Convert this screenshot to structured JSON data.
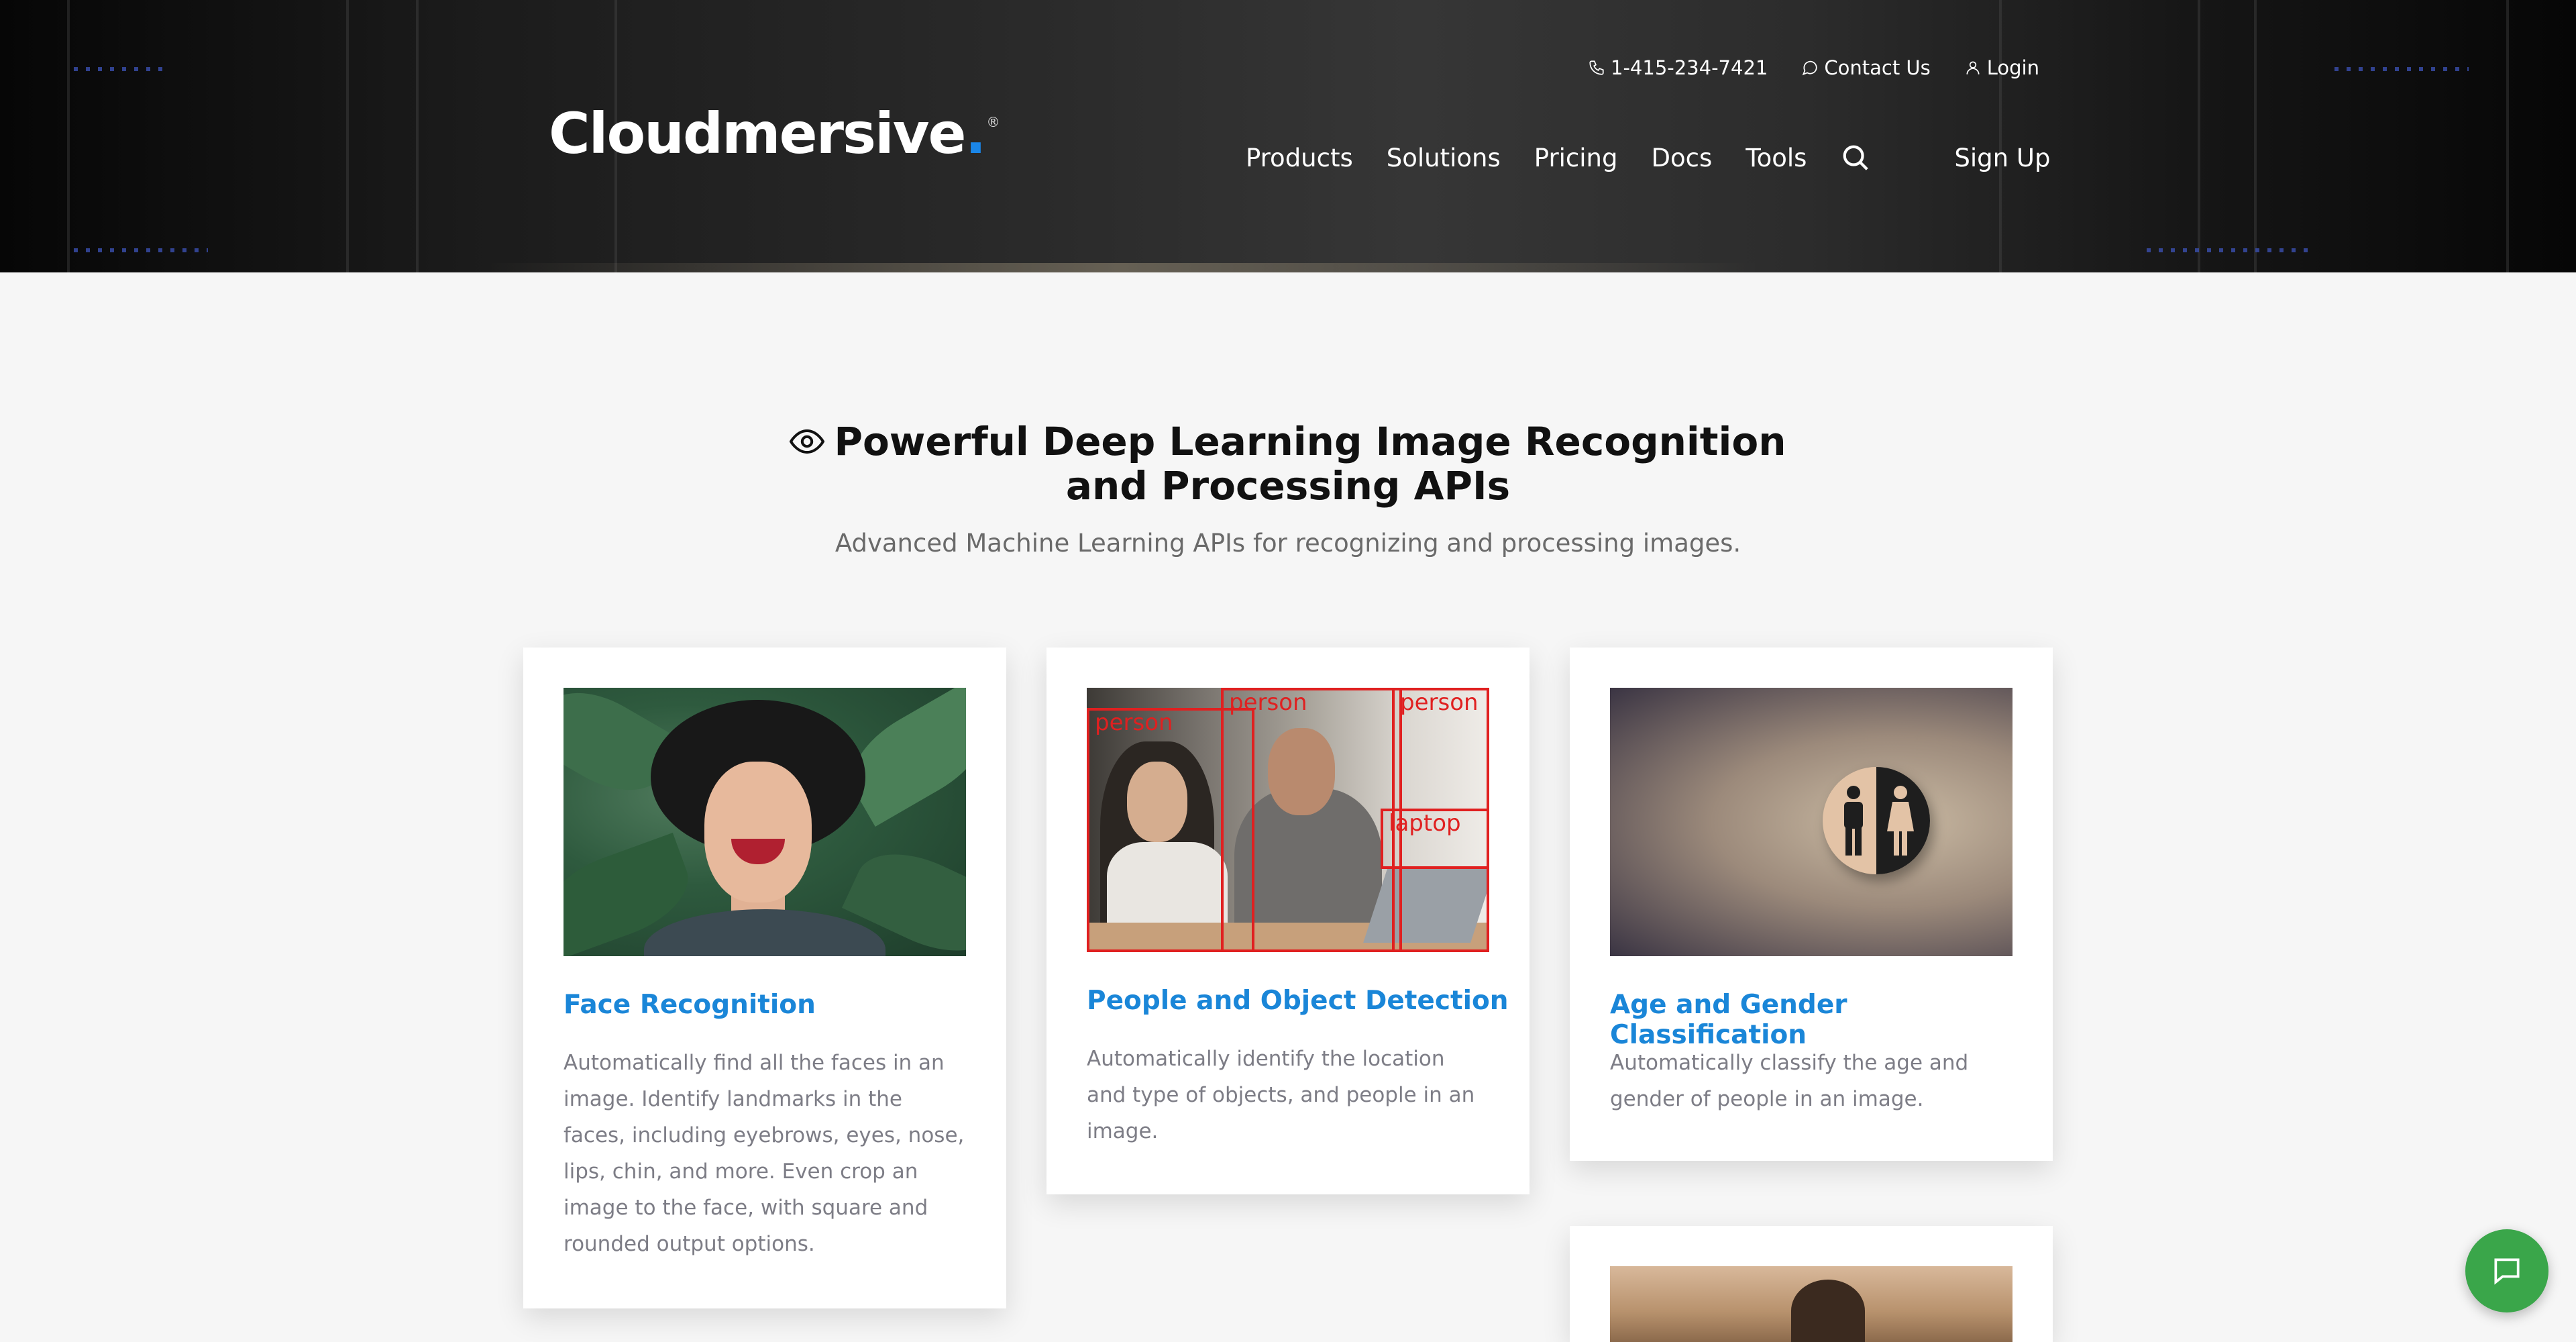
{
  "header": {
    "logo": {
      "text": "Cloudmersive",
      "dot": ".",
      "registered": "®"
    },
    "utility_nav": {
      "phone": {
        "label": "1-415-234-7421",
        "icon": "phone-icon"
      },
      "contact": {
        "label": "Contact Us",
        "icon": "chat-bubble-icon"
      },
      "login": {
        "label": "Login",
        "icon": "user-icon"
      }
    },
    "main_nav": [
      {
        "label": "Products"
      },
      {
        "label": "Solutions"
      },
      {
        "label": "Pricing"
      },
      {
        "label": "Docs"
      },
      {
        "label": "Tools"
      }
    ],
    "search_icon": "search-icon",
    "signup_label": "Sign Up"
  },
  "hero": {
    "icon": "eye-icon",
    "title": "Powerful Deep Learning Image Recognition and Processing APIs",
    "subtitle": "Advanced Machine Learning APIs for recognizing and processing images."
  },
  "cards": [
    {
      "title": "Face Recognition",
      "description": "Automatically find all the faces in an image. Identify landmarks in the faces, including eyebrows, eyes, nose, lips, chin, and more. Even crop an image to the face, with square and rounded output options."
    },
    {
      "title": "People and Object Detection",
      "description": "Automatically identify the location and type of objects, and people in an image.",
      "detections": [
        "person",
        "person",
        "person",
        "laptop"
      ]
    },
    {
      "title": "Age and Gender Classification",
      "description": "Automatically classify the age and gender of people in an image."
    }
  ],
  "chat_button": {
    "icon": "chat-icon"
  },
  "colors": {
    "accent": "#1a86d8",
    "logo_dot": "#1a86e8",
    "chat": "#3aa64a",
    "detection_box": "#e02020"
  }
}
